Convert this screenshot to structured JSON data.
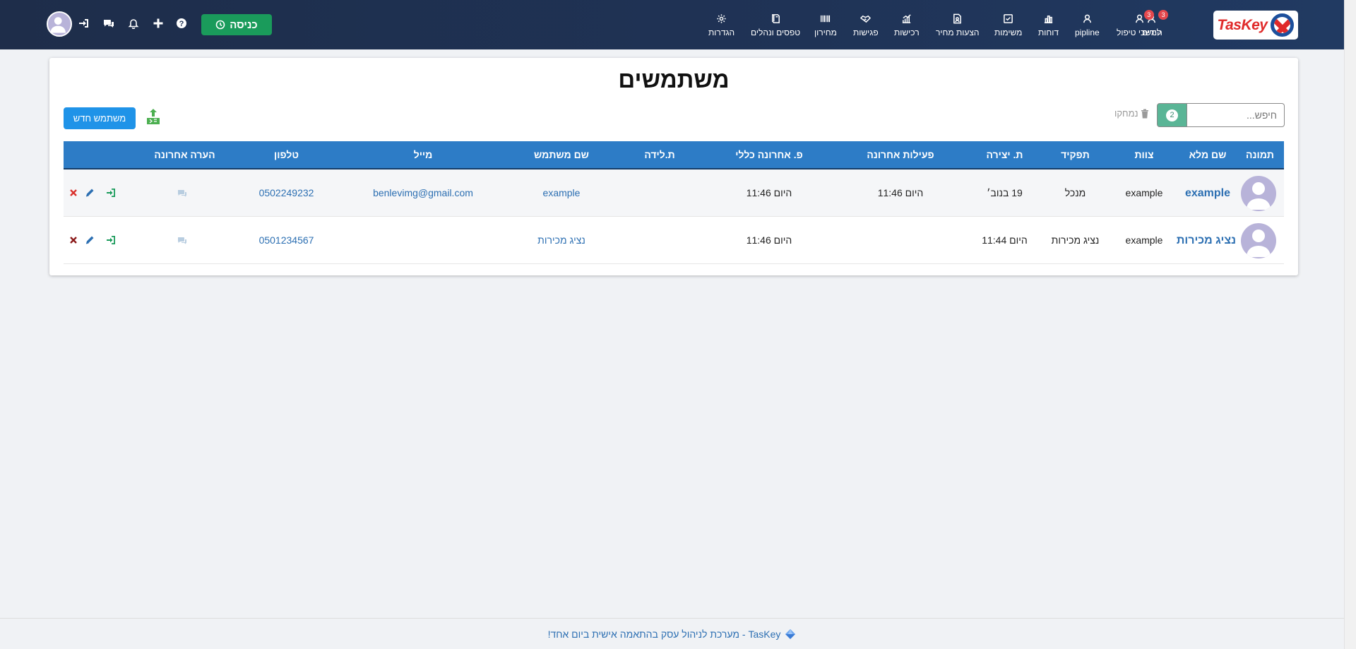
{
  "app": {
    "logo_text": "TasKey"
  },
  "nav": {
    "items": [
      {
        "label": "לידים",
        "icon": "users-icon",
        "badge": "3"
      },
      {
        "label": "המשכי טיפול",
        "icon": "users-icon",
        "badge": "3"
      },
      {
        "label": "pipline",
        "icon": "users-icon",
        "badge": ""
      },
      {
        "label": "דוחות",
        "icon": "bar-chart-icon",
        "badge": ""
      },
      {
        "label": "משימות",
        "icon": "checkbox-icon",
        "badge": ""
      },
      {
        "label": "הצעות מחיר",
        "icon": "file-icon",
        "badge": ""
      },
      {
        "label": "רכישות",
        "icon": "growth-chart-icon",
        "badge": ""
      },
      {
        "label": "פגישות",
        "icon": "handshake-icon",
        "badge": ""
      },
      {
        "label": "מחירון",
        "icon": "barcode-icon",
        "badge": ""
      },
      {
        "label": "טפסים ונהלים",
        "icon": "book-icon",
        "badge": ""
      },
      {
        "label": "הגדרות",
        "icon": "gear-icon",
        "badge": ""
      }
    ],
    "enter_label": "כניסה"
  },
  "page": {
    "title": "משתמשים",
    "search_placeholder": "חיפש...",
    "count": "2",
    "deleted_label": "נמחקו",
    "new_user_label": "משתמש חדש"
  },
  "table": {
    "columns": {
      "photo": "תמונה",
      "fullname": "שם מלא",
      "team": "צוות",
      "role": "תפקיד",
      "created": "ת. יצירה",
      "last_activity": "פעילות אחרונה",
      "last_general": "פ. אחרונה כללי",
      "birthday": "ת.לידה",
      "username": "שם משתמש",
      "email": "מייל",
      "phone": "טלפון",
      "last_note": "הערה אחרונה"
    },
    "rows": [
      {
        "fullname": "example",
        "team": "example",
        "role": "מנכל",
        "created": "19 בנוב׳",
        "last_activity": "היום 11:46",
        "last_general": "היום 11:46",
        "birthday": "",
        "username": "example",
        "email": "benlevimg@gmail.com",
        "phone": "0502249232"
      },
      {
        "fullname": "נציג מכירות",
        "team": "example",
        "role": "נציג מכירות",
        "created": "היום 11:44",
        "last_activity": "",
        "last_general": "היום 11:46",
        "birthday": "",
        "username": "נציג מכירות",
        "email": "",
        "phone": "0501234567"
      }
    ]
  },
  "footer": {
    "text": "TasKey - מערכת לניהול עסק בהתאמה אישית ביום אחד!"
  },
  "colors": {
    "navbar": "#1f3356",
    "enter_button": "#1a9b5b",
    "table_header": "#2d7cc6",
    "new_user_button": "#1f93e8",
    "count_badge": "#5ab596",
    "link": "#2c6fb2",
    "notification_badge": "#e5484d"
  }
}
